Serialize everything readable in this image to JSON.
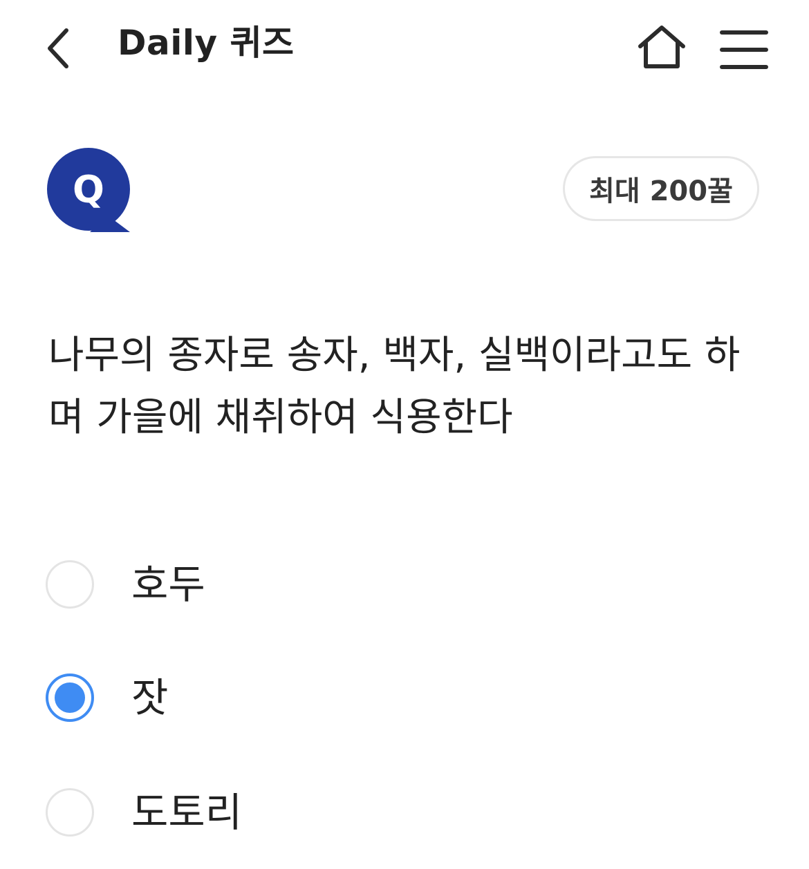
{
  "header": {
    "title": "Daily 퀴즈",
    "back_icon": "chevron-left-icon",
    "home_icon": "home-icon",
    "menu_icon": "hamburger-menu-icon"
  },
  "quiz": {
    "badge_letter": "Q",
    "badge_color": "#213a9c",
    "reward_label": "최대 200꿀",
    "question": "나무의 종자로 송자, 백자, 실백이라고도 하며 가을에 채취하여 식용한다",
    "options": [
      {
        "label": "호두",
        "selected": false
      },
      {
        "label": "잣",
        "selected": true
      },
      {
        "label": "도토리",
        "selected": false
      }
    ],
    "accent_color": "#3f8cf3"
  }
}
